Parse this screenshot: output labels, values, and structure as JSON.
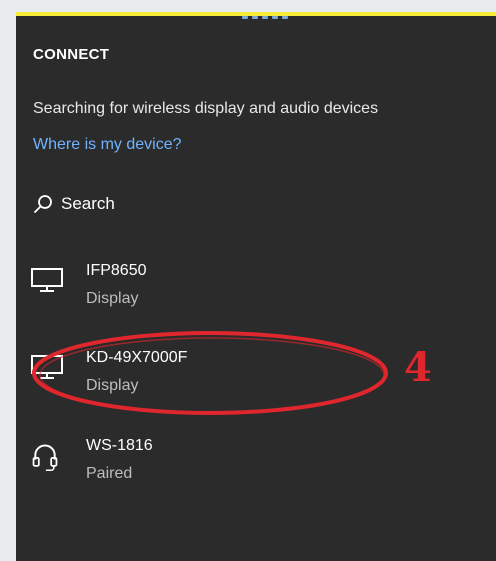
{
  "panel": {
    "title": "CONNECT",
    "status": "Searching for wireless display and audio devices",
    "help_link": "Where is my device?",
    "search_label": "Search"
  },
  "devices": [
    {
      "name": "IFP8650",
      "sub": "Display",
      "icon": "monitor-icon"
    },
    {
      "name": "KD-49X7000F",
      "sub": "Display",
      "icon": "monitor-icon"
    },
    {
      "name": "WS-1816",
      "sub": "Paired",
      "icon": "headset-icon"
    }
  ],
  "annotation": {
    "label": "4",
    "color": "#e0272d"
  },
  "colors": {
    "panel_bg": "#2b2b2b",
    "link": "#6fb3ff",
    "accent_top": "#f6ec3a"
  }
}
